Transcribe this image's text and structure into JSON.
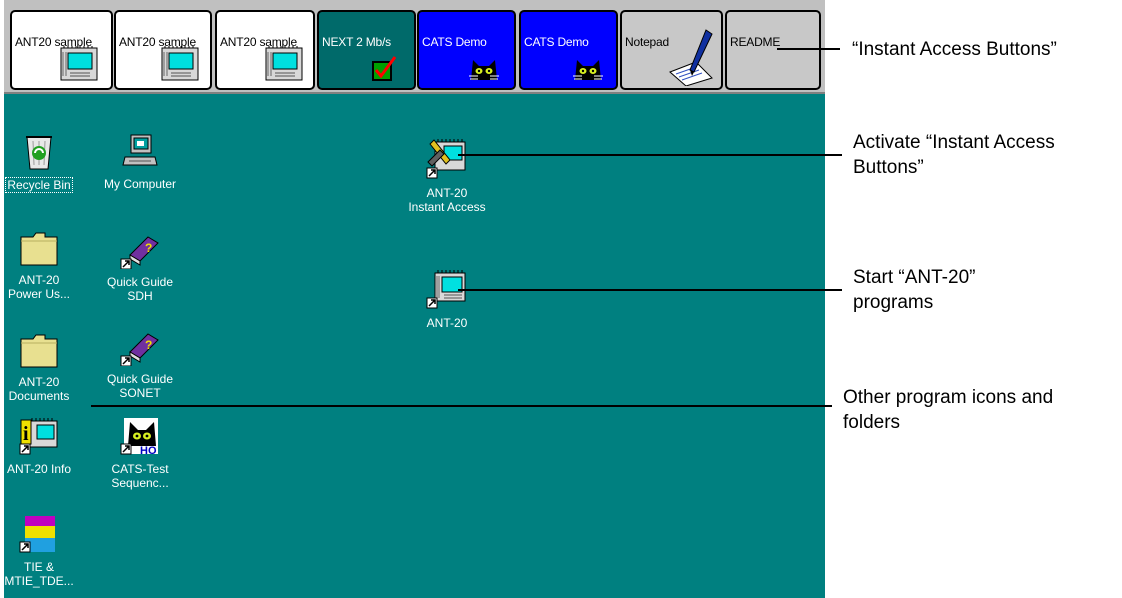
{
  "toolbar": {
    "buttons": [
      {
        "label": "ANT20 sample",
        "style": "white",
        "icon": "ant20-device-icon"
      },
      {
        "label": "ANT20 sample",
        "style": "white",
        "icon": "ant20-device-icon"
      },
      {
        "label": "ANT20 sample",
        "style": "white",
        "icon": "ant20-device-icon"
      },
      {
        "label": "NEXT 2 Mb/s",
        "style": "teal",
        "icon": "checkbox-checked-icon"
      },
      {
        "label": "CATS Demo",
        "style": "blue",
        "icon": "cat-icon"
      },
      {
        "label": "CATS Demo",
        "style": "blue",
        "icon": "cat-icon"
      },
      {
        "label": "Notepad",
        "style": "gray",
        "icon": "notepad-pen-icon"
      },
      {
        "label": "README",
        "style": "gray",
        "icon": ""
      }
    ]
  },
  "desktop": {
    "icons": [
      {
        "label": "Recycle Bin",
        "icon": "recycle-bin-icon"
      },
      {
        "label": "My Computer",
        "icon": "computer-icon"
      },
      {
        "label": "ANT-20\nInstant Access",
        "icon": "instant-access-tool-icon"
      },
      {
        "label": "ANT-20\nPower Us...",
        "icon": "folder-icon"
      },
      {
        "label": "Quick Guide\nSDH",
        "icon": "help-book-icon"
      },
      {
        "label": "ANT-20",
        "icon": "ant20-device-icon"
      },
      {
        "label": "ANT-20\nDocuments",
        "icon": "folder-icon"
      },
      {
        "label": "Quick Guide\nSONET",
        "icon": "help-book-icon"
      },
      {
        "label": "ANT-20 Info",
        "icon": "ant20-info-icon"
      },
      {
        "label": "CATS-Test\nSequenc...",
        "icon": "cats-ho-icon"
      },
      {
        "label": "TIE &\nMTIE_TDE...",
        "icon": "mtie-demo-icon"
      }
    ]
  },
  "callouts": [
    {
      "text": "“Instant Access Buttons”"
    },
    {
      "text": "Activate “Instant Access Buttons”"
    },
    {
      "text": "Start “ANT-20” programs"
    },
    {
      "text": "Other program icons and folders"
    }
  ],
  "colors": {
    "desktop": "#008080",
    "toolbar": "#c0c0c0",
    "button_blue": "#0000ff",
    "button_teal": "#006a6a"
  }
}
